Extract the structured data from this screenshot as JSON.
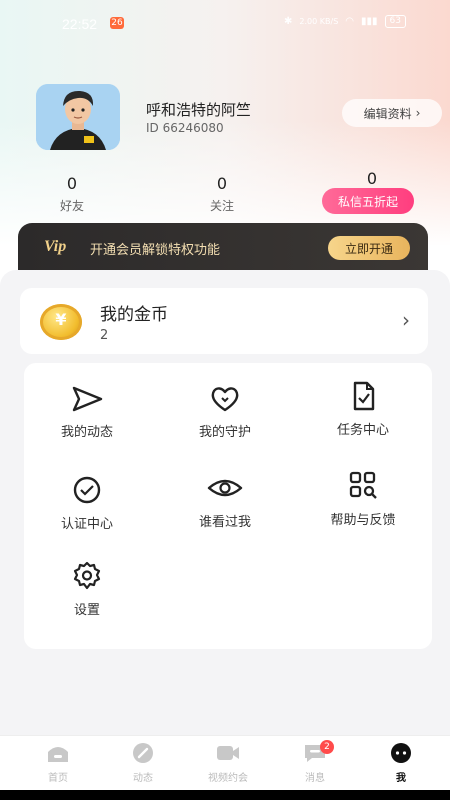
{
  "status": {
    "time": "22:52",
    "notif_badge": "26",
    "battery": "63",
    "signal_label": "2.00 KB/S"
  },
  "profile": {
    "name": "呼和浩特的阿竺",
    "id_text": "ID 66246080",
    "edit_label": "编辑资料",
    "edit_chevron": "›"
  },
  "stats": [
    {
      "value": "0",
      "label": "好友"
    },
    {
      "value": "0",
      "label": "关注"
    },
    {
      "value": "0",
      "label": ""
    }
  ],
  "promo_badge": "私信五折起",
  "vip": {
    "logo": "Vip",
    "text": "开通会员解锁特权功能",
    "button": "立即开通"
  },
  "coins": {
    "title": "我的金币",
    "count": "2",
    "chevron": "›",
    "icon_symbol": "¥"
  },
  "menu": [
    {
      "label": "我的动态",
      "icon": "send-icon"
    },
    {
      "label": "我的守护",
      "icon": "heart-icon"
    },
    {
      "label": "任务中心",
      "icon": "task-doc-icon"
    },
    {
      "label": "认证中心",
      "icon": "verify-check-icon"
    },
    {
      "label": "谁看过我",
      "icon": "eye-icon"
    },
    {
      "label": "帮助与反馈",
      "icon": "help-grid-icon"
    },
    {
      "label": "设置",
      "icon": "gear-icon"
    }
  ],
  "nav": [
    {
      "label": "首页",
      "icon": "home-icon"
    },
    {
      "label": "动态",
      "icon": "pen-icon"
    },
    {
      "label": "视频约会",
      "icon": "video-icon"
    },
    {
      "label": "消息",
      "icon": "message-icon",
      "badge": "2"
    },
    {
      "label": "我",
      "icon": "me-icon",
      "active": true
    }
  ],
  "colors": {
    "accent_pink": "#ff3e7f",
    "vip_gold": "#f1d18a",
    "vip_dark": "#2c2a2a",
    "badge_red": "#ff4b4b"
  }
}
